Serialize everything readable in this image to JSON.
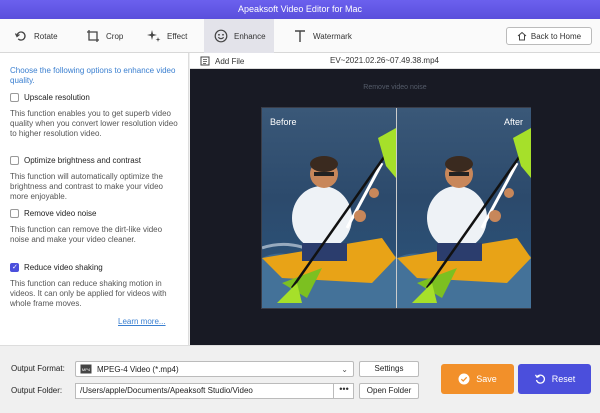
{
  "window": {
    "title": "Apeaksoft Video Editor for Mac"
  },
  "toolbar": {
    "tools": [
      {
        "label": "Rotate",
        "icon": "rotate-icon"
      },
      {
        "label": "Crop",
        "icon": "crop-icon"
      },
      {
        "label": "Effect",
        "icon": "effect-icon"
      },
      {
        "label": "Enhance",
        "icon": "enhance-icon",
        "active": true
      },
      {
        "label": "Watermark",
        "icon": "watermark-icon"
      }
    ],
    "back_label": "Back to Home"
  },
  "sidebar": {
    "intro": "Choose the following options to enhance video quality.",
    "options": [
      {
        "label": "Upscale resolution",
        "checked": false,
        "desc": "This function enables you to get superb video quality when you convert lower resolution video to higher resolution video."
      },
      {
        "label": "Optimize brightness and contrast",
        "checked": false,
        "desc": "This function will automatically optimize the brightness and contrast to make your video more enjoyable."
      },
      {
        "label": "Remove video noise",
        "checked": false,
        "desc": "This function can remove the dirt-like video noise and make your video cleaner."
      },
      {
        "label": "Reduce video shaking",
        "checked": true,
        "desc": "This function can reduce shaking motion in videos. It can only be applied for videos with whole frame moves."
      }
    ],
    "learn_more": "Learn more..."
  },
  "preview": {
    "add_file": "Add File",
    "file_name": "EV~2021.02.26~07.49.38.mp4",
    "hint": "Remove video noise",
    "before_label": "Before",
    "after_label": "After"
  },
  "output": {
    "format_label": "Output Format:",
    "format_value": "MPEG-4 Video (*.mp4)",
    "settings_label": "Settings",
    "folder_label": "Output Folder:",
    "folder_value": "/Users/apple/Documents/Apeaksoft Studio/Video",
    "browse_label": "•••",
    "open_folder_label": "Open Folder"
  },
  "actions": {
    "save_label": "Save",
    "reset_label": "Reset"
  },
  "colors": {
    "accent": "#4b4fdc",
    "save": "#f2902a",
    "title_bar": "#5a4fdc",
    "link": "#3a7fd0"
  }
}
